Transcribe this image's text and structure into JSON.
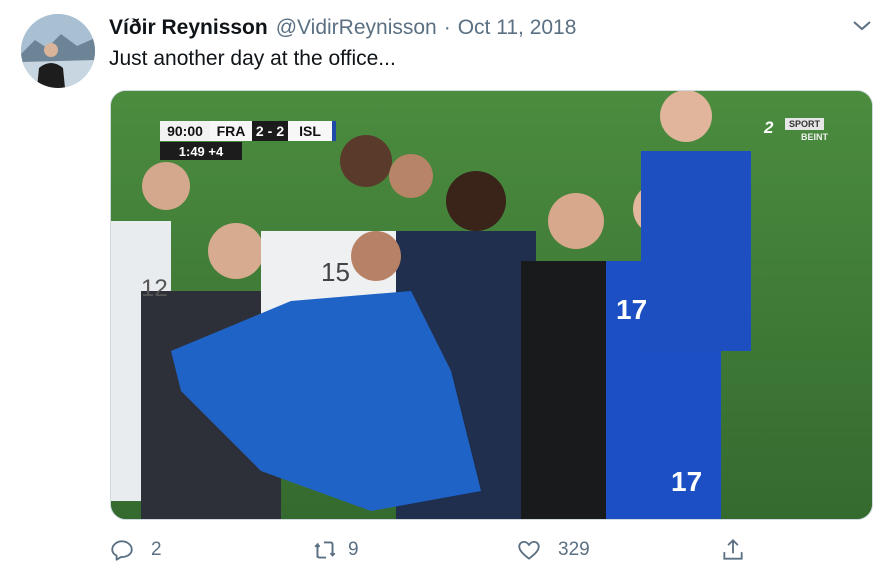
{
  "tweet": {
    "display_name": "Víðir Reynisson",
    "handle": "@VidirReynisson",
    "separator": "·",
    "date": "Oct 11, 2018",
    "text": "Just another day at the office...",
    "media": {
      "scoreboard": {
        "clock": "90:00",
        "home_team": "FRA",
        "home_score": "2",
        "score_dash": "-",
        "away_score": "2",
        "away_team": "ISL",
        "added_time": "1:49 +4"
      },
      "channel": {
        "number": "2",
        "label": "SPORT",
        "sub_label": "BEINT"
      },
      "jersey_numbers": [
        "12",
        "15",
        "17",
        "17"
      ]
    }
  },
  "actions": {
    "reply": {
      "icon": "reply-icon",
      "count": "2"
    },
    "retweet": {
      "icon": "retweet-icon",
      "count": "9"
    },
    "like": {
      "icon": "heart-icon",
      "count": "329"
    },
    "share": {
      "icon": "share-icon"
    }
  },
  "colors": {
    "text_primary": "#0f1419",
    "text_secondary": "#5b7083",
    "pitch_green": "#3f7a37",
    "iceland_blue": "#1d4fc4"
  }
}
